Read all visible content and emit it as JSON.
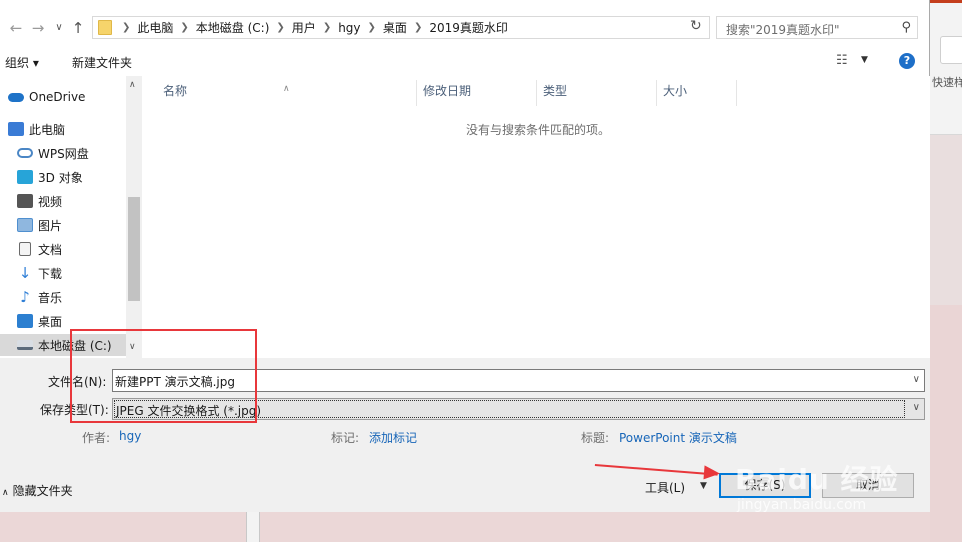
{
  "address": {
    "crumbs": [
      "此电脑",
      "本地磁盘 (C:)",
      "用户",
      "hgy",
      "桌面",
      "2019真题水印"
    ],
    "search_placeholder": "搜索\"2019真题水印\""
  },
  "toolbar": {
    "organize": "组织 ▾",
    "new_folder": "新建文件夹",
    "help": "?"
  },
  "nav": {
    "items": [
      {
        "label": "OneDrive",
        "icon": "cloud-icon",
        "color": "#1e73c8"
      },
      {
        "label": "此电脑",
        "icon": "computer-icon",
        "color": "#3a7bd5"
      },
      {
        "label": "WPS网盘",
        "icon": "wps-cloud-icon",
        "color": "#4a86c5"
      },
      {
        "label": "3D 对象",
        "icon": "cube-icon",
        "color": "#27a4d8"
      },
      {
        "label": "视频",
        "icon": "video-icon",
        "color": "#555555"
      },
      {
        "label": "图片",
        "icon": "picture-icon",
        "color": "#4f8fcf"
      },
      {
        "label": "文档",
        "icon": "document-icon",
        "color": "#6a6a6a"
      },
      {
        "label": "下载",
        "icon": "download-icon",
        "color": "#2f7fd6"
      },
      {
        "label": "音乐",
        "icon": "music-icon",
        "color": "#2f7fd6"
      },
      {
        "label": "桌面",
        "icon": "desktop-icon",
        "color": "#2c7fd0"
      },
      {
        "label": "本地磁盘 (C:)",
        "icon": "drive-icon",
        "color": "#5b6b7c"
      }
    ]
  },
  "files": {
    "columns": [
      "名称",
      "修改日期",
      "类型",
      "大小"
    ],
    "empty_message": "没有与搜索条件匹配的项。"
  },
  "form": {
    "filename_label": "文件名(N):",
    "filename_value": "新建PPT 演示文稿.jpg",
    "filetype_label": "保存类型(T):",
    "filetype_value": "JPEG 文件交换格式 (*.jpg)",
    "author_key": "作者:",
    "author_value": "hgy",
    "tags_key": "标记:",
    "tags_value": "添加标记",
    "title_key": "标题:",
    "title_value": "PowerPoint 演示文稿",
    "hide_folders": "隐藏文件夹",
    "tools": "工具(L)",
    "save": "保存(S)",
    "cancel": "取消"
  },
  "background": {
    "quick_style": "快速样"
  },
  "watermark": {
    "brand": "Baidu 经验",
    "url": "jingyan.baidu.com"
  },
  "colors": {
    "annotation": "#e8373b",
    "link": "#1866b8",
    "accent": "#0078d7"
  }
}
